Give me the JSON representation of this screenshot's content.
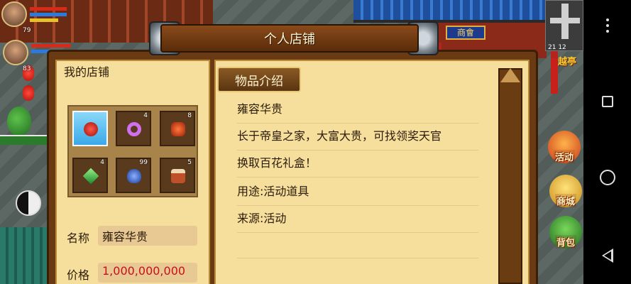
{
  "dialog": {
    "title": "个人店铺",
    "shop_label": "我的店铺",
    "tab_label": "物品介绍"
  },
  "inventory": [
    {
      "qty": "",
      "item": "red-flower",
      "color": "#c8201a",
      "selected": true
    },
    {
      "qty": "4",
      "item": "purple-ring",
      "color": "#c050e0",
      "selected": false
    },
    {
      "qty": "8",
      "item": "red-lantern",
      "color": "#d83a1a",
      "selected": false
    },
    {
      "qty": "4",
      "item": "green-gem",
      "color": "#3ad04a",
      "selected": false
    },
    {
      "qty": "99",
      "item": "blue-potion",
      "color": "#4a78d8",
      "selected": false
    },
    {
      "qty": "5",
      "item": "drum",
      "color": "#c86a3a",
      "selected": false
    }
  ],
  "fields": {
    "name_label": "名称",
    "name_value": "雍容华贵",
    "price_label": "价格",
    "price_value": "1,000,000,000"
  },
  "description": [
    "雍容华贵",
    "长于帝皇之家，大富大贵，可找领奖天官",
    "换取百花礼盒！",
    "用途:活动道具",
    "来源:活动",
    ""
  ],
  "hud": {
    "player_level": "79",
    "pet_level": "83",
    "shop_sign": "商會",
    "coords": "21 12",
    "place_name": "越亭"
  },
  "side_buttons": [
    {
      "label": "活动",
      "color": "#e0502a"
    },
    {
      "label": "商城",
      "color": "#e8a22a"
    },
    {
      "label": "背包",
      "color": "#3a9a3a"
    }
  ],
  "colors": {
    "panel": "#f6df9c",
    "frame": "#6a3a12",
    "price_text": "#c8101a"
  }
}
